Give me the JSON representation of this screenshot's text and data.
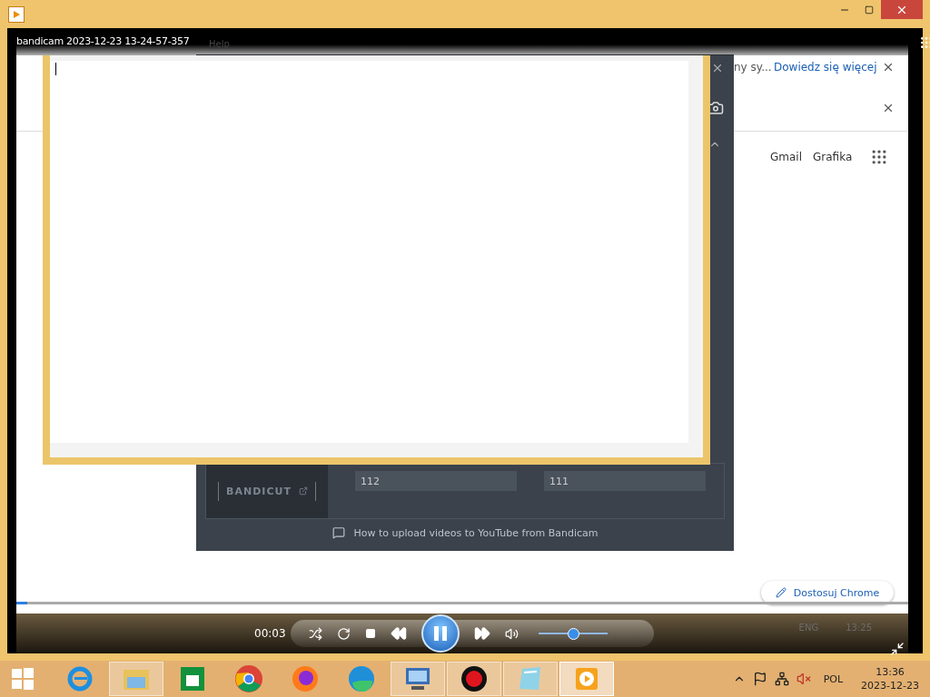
{
  "player": {
    "overlay_title": "bandicam 2023-12-23 13-24-57-357",
    "time": "00:03",
    "playing": true,
    "seek": {
      "level": 0.012
    },
    "volume": {
      "level": 0.5
    }
  },
  "recording": {
    "menu_item": "Help",
    "notice_text": "ny sy...",
    "notice_link": "Dowiedz się więcej",
    "links": [
      "Gmail",
      "Grafika"
    ],
    "customize_button": "Dostosuj Chrome",
    "bandicut": "BANDICUT",
    "fields": [
      "112",
      "111"
    ],
    "help_link": "How to upload videos to YouTube from Bandicam",
    "tray_lang": "ENG",
    "tray_time": "13:25"
  },
  "taskbar": {
    "apps": [
      {
        "kind": "ie",
        "open": false,
        "selected": false
      },
      {
        "kind": "explorer",
        "open": true,
        "selected": false
      },
      {
        "kind": "store",
        "open": false,
        "selected": false
      },
      {
        "kind": "chrome",
        "open": false,
        "selected": false
      },
      {
        "kind": "firefox",
        "open": false,
        "selected": false
      },
      {
        "kind": "edge",
        "open": false,
        "selected": false
      },
      {
        "kind": "remote",
        "open": true,
        "selected": false
      },
      {
        "kind": "record",
        "open": true,
        "selected": false
      },
      {
        "kind": "notes",
        "open": true,
        "selected": false
      },
      {
        "kind": "player",
        "open": true,
        "selected": true
      }
    ],
    "lang": "POL",
    "time": "13:36",
    "date": "2023-12-23"
  }
}
